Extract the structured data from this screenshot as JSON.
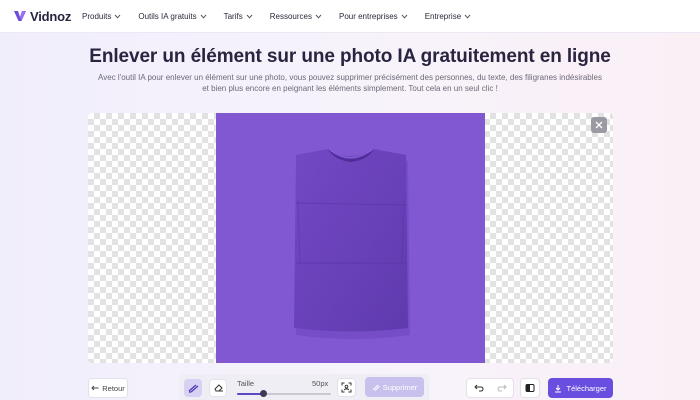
{
  "header": {
    "logo_text": "Vidnoz",
    "nav": [
      {
        "label": "Produits"
      },
      {
        "label": "Outils IA gratuits"
      },
      {
        "label": "Tarifs"
      },
      {
        "label": "Ressources"
      },
      {
        "label": "Pour entreprises"
      },
      {
        "label": "Entreprise"
      }
    ]
  },
  "hero": {
    "title": "Enlever un élément sur une photo IA gratuitement en ligne",
    "subtitle": "Avec l'outil IA pour enlever un élément sur une photo, vous pouvez supprimer précisément des personnes, du texte, des filigranes indésirables et bien plus encore en peignant les éléments simplement. Tout cela en un seul clic !"
  },
  "editor": {
    "image_subject": "purple-tshirt-on-purple-background",
    "background_color": "#8257d2",
    "tshirt_color": "#6a42b8"
  },
  "toolbar": {
    "back_label": "Retour",
    "size_label": "Taille",
    "size_value": "50px",
    "size_fraction": 0.28,
    "remove_label": "Supprimer",
    "download_label": "Télécharger"
  },
  "colors": {
    "accent": "#6a4ee0",
    "remove_disabled": "#c8c1ee",
    "brush_active": "#d8d1f3"
  },
  "icons": {
    "logo": "vidnoz-logo-icon",
    "close": "close-icon",
    "brush": "brush-icon",
    "eraser": "eraser-icon",
    "scan": "scan-icon",
    "undo": "undo-icon",
    "redo": "redo-icon",
    "compare": "compare-icon",
    "download": "download-icon",
    "back": "arrow-left-icon"
  }
}
